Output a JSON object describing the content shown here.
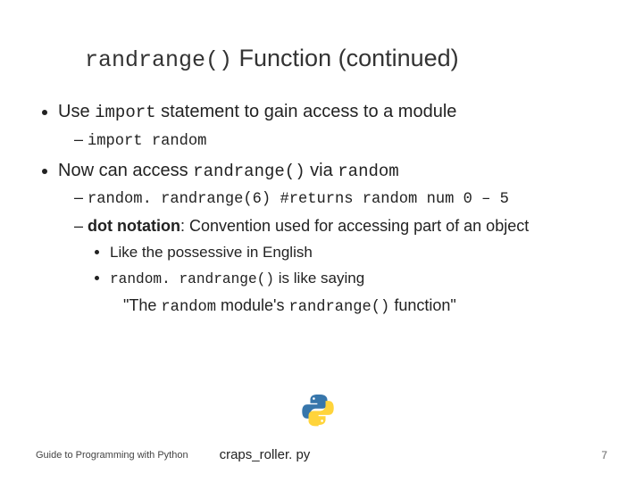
{
  "title": {
    "code": "randrange()",
    "rest": " Function (continued)"
  },
  "b1": {
    "pre": "Use ",
    "code": "import",
    "post": " statement to gain access to a module",
    "sub": "import random"
  },
  "b2": {
    "pre": "Now can access ",
    "code1": "randrange()",
    "mid": " via ",
    "code2": "random",
    "sub_code": "random. randrange(6)",
    "sub_comment": "   #returns random num 0 – 5"
  },
  "dot": {
    "bold": "dot notation",
    "rest": ": Convention used for accessing part of an object",
    "e1": "Like the possessive in English",
    "e2_code": "random. randrange()",
    "e2_post": " is like saying",
    "quote_pre": "\"The ",
    "quote_c1": "random",
    "quote_mid": " module's ",
    "quote_c2": "randrange()",
    "quote_post": " function\""
  },
  "footer": {
    "guide": "Guide to Programming with Python",
    "file": "craps_roller. py",
    "page": "7"
  }
}
